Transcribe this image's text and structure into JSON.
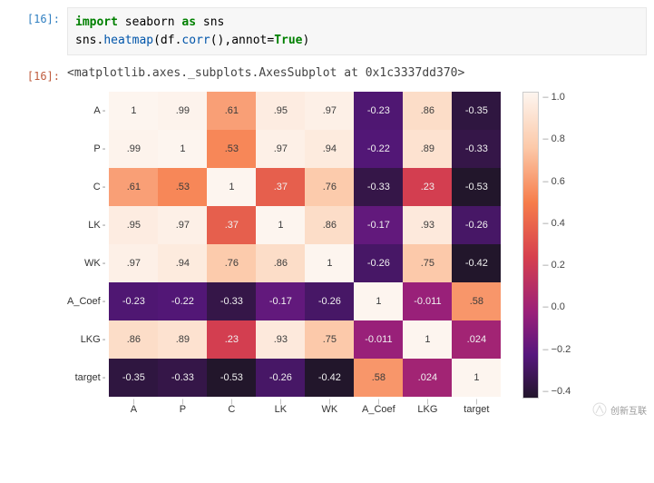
{
  "cells": {
    "input_prompt": "[16]:",
    "output_prompt": "[16]:",
    "code_lines": {
      "l1_kw": "import",
      "l1_rest": " seaborn ",
      "l1_as": "as",
      "l1_alias": " sns",
      "l2_pre": "sns.",
      "l2_fn1": "heatmap",
      "l2_mid": "(df.",
      "l2_fn2": "corr",
      "l2_mid2": "(),annot=",
      "l2_true": "True",
      "l2_end": ")"
    },
    "output_text": "<matplotlib.axes._subplots.AxesSubplot at 0x1c3337dd370>"
  },
  "chart_data": {
    "type": "heatmap",
    "title": "",
    "xlabel": "",
    "ylabel": "",
    "categories": [
      "A",
      "P",
      "C",
      "LK",
      "WK",
      "A_Coef",
      "LKG",
      "target"
    ],
    "series": [
      {
        "name": "A",
        "values": [
          1,
          0.99,
          0.61,
          0.95,
          0.97,
          -0.23,
          0.86,
          -0.35
        ]
      },
      {
        "name": "P",
        "values": [
          0.99,
          1,
          0.53,
          0.97,
          0.94,
          -0.22,
          0.89,
          -0.33
        ]
      },
      {
        "name": "C",
        "values": [
          0.61,
          0.53,
          1,
          0.37,
          0.76,
          -0.33,
          0.23,
          -0.53
        ]
      },
      {
        "name": "LK",
        "values": [
          0.95,
          0.97,
          0.37,
          1,
          0.86,
          -0.17,
          0.93,
          -0.26
        ]
      },
      {
        "name": "WK",
        "values": [
          0.97,
          0.94,
          0.76,
          0.86,
          1,
          -0.26,
          0.75,
          -0.42
        ]
      },
      {
        "name": "A_Coef",
        "values": [
          -0.23,
          -0.22,
          -0.33,
          -0.17,
          -0.26,
          1,
          -0.011,
          0.58
        ]
      },
      {
        "name": "LKG",
        "values": [
          0.86,
          0.89,
          0.23,
          0.93,
          0.75,
          -0.011,
          1,
          0.024
        ]
      },
      {
        "name": "target",
        "values": [
          -0.35,
          -0.33,
          -0.53,
          -0.26,
          -0.42,
          0.58,
          0.024,
          1
        ]
      }
    ],
    "colorbar_ticks": [
      "1.0",
      "0.8",
      "0.6",
      "0.4",
      "0.2",
      "0.0",
      "−0.2",
      "−0.4"
    ],
    "vmin": -0.53,
    "vmax": 1.0
  },
  "watermark": "创新互联"
}
